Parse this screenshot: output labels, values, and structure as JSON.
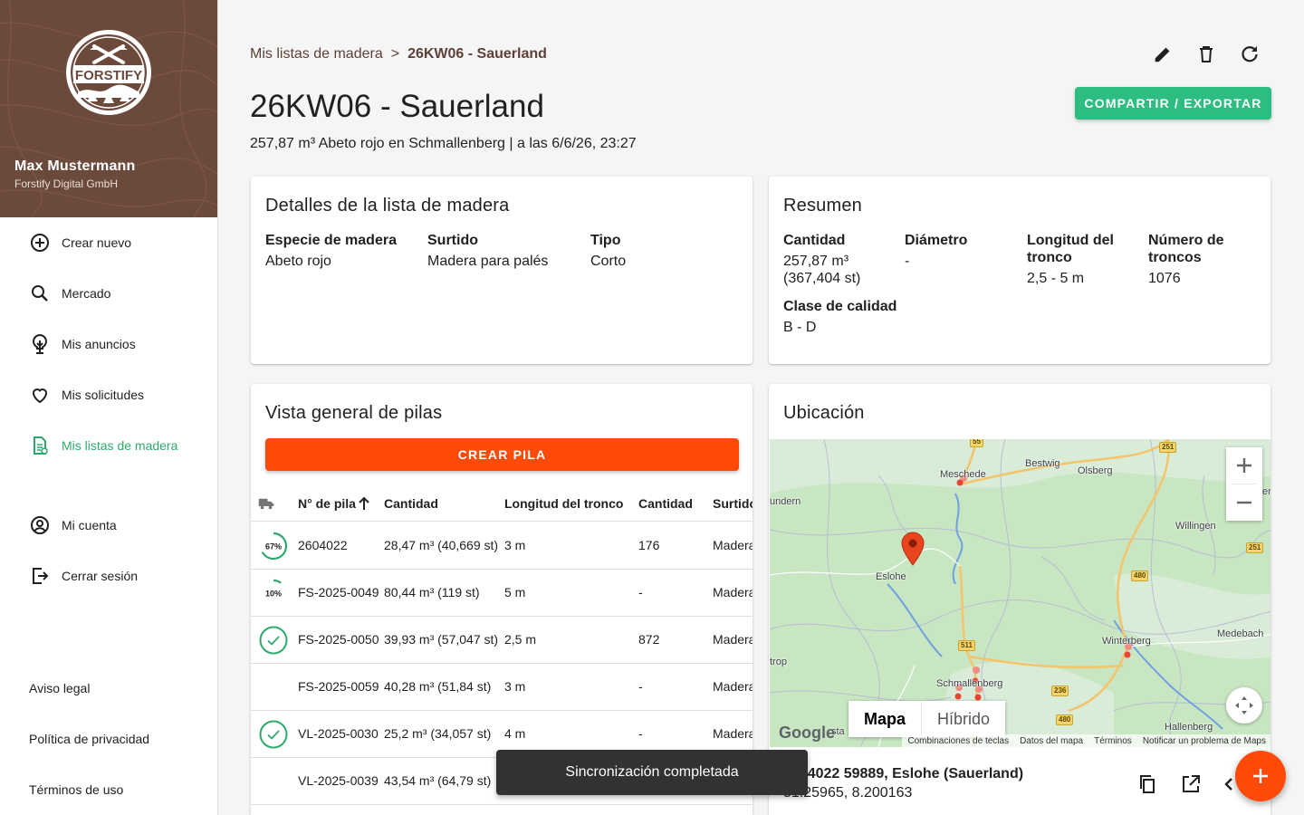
{
  "user": {
    "name": "Max Mustermann",
    "org": "Forstify Digital GmbH",
    "logo_text": "FORSTIFY"
  },
  "nav": [
    {
      "label": "Crear nuevo",
      "icon": "plus-circle-icon"
    },
    {
      "label": "Mercado",
      "icon": "search-icon"
    },
    {
      "label": "Mis anuncios",
      "icon": "tree-icon"
    },
    {
      "label": "Mis solicitudes",
      "icon": "heart-icon"
    },
    {
      "label": "Mis listas de madera",
      "icon": "document-list-icon",
      "active": true
    },
    {
      "label": "Mi cuenta",
      "icon": "account-icon"
    },
    {
      "label": "Cerrar sesión",
      "icon": "logout-icon"
    }
  ],
  "footer_links": [
    "Aviso legal",
    "Política de privacidad",
    "Términos de uso"
  ],
  "breadcrumb": {
    "parent": "Mis listas de madera",
    "separator": ">",
    "current": "26KW06 - Sauerland"
  },
  "page": {
    "title": "26KW06 - Sauerland",
    "subtitle": "257,87 m³ Abeto rojo en Schmallenberg | a las 6/6/26, 23:27",
    "share_button": "COMPARTIR / EXPORTAR"
  },
  "details": {
    "title": "Detalles de la lista de madera",
    "fields": [
      {
        "label": "Especie de madera",
        "value": "Abeto rojo"
      },
      {
        "label": "Surtido",
        "value": "Madera para palés"
      },
      {
        "label": "Tipo",
        "value": "Corto"
      }
    ]
  },
  "summary": {
    "title": "Resumen",
    "fields": [
      {
        "label": "Cantidad",
        "value": "257,87 m³\n(367,404 st)"
      },
      {
        "label": "Diámetro",
        "value": "-"
      },
      {
        "label": "Longitud del\ntronco",
        "value": "2,5 - 5 m"
      },
      {
        "label": "Número de\ntroncos",
        "value": "1076"
      },
      {
        "label": "Clase de calidad",
        "value": "B - D"
      }
    ]
  },
  "piles": {
    "title": "Vista general de pilas",
    "create_button": "CREAR PILA",
    "columns": [
      "N° de pila",
      "Cantidad",
      "Longitud del tronco",
      "Cantidad",
      "Surtido"
    ],
    "rows": [
      {
        "status": "progress",
        "progress": 0.67,
        "progress_label": "67%",
        "id": "2604022",
        "quantity": "28,47 m³ (40,669 st)",
        "length": "3 m",
        "count": "176",
        "assortment": "Madera para palés"
      },
      {
        "status": "progress",
        "progress": 0.1,
        "progress_label": "10%",
        "id": "FS-2025-0049",
        "quantity": "80,44 m³ (119 st)",
        "length": "5 m",
        "count": "-",
        "assortment": "Madera para palés"
      },
      {
        "status": "done",
        "id": "FS-2025-0050",
        "quantity": "39,93 m³ (57,047 st)",
        "length": "2,5 m",
        "count": "872",
        "assortment": "Madera para palés"
      },
      {
        "status": "none",
        "id": "FS-2025-0059",
        "quantity": "40,28 m³ (51,84 st)",
        "length": "3 m",
        "count": "-",
        "assortment": "Madera para palés"
      },
      {
        "status": "done",
        "id": "VL-2025-0030",
        "quantity": "25,2 m³ (34,057 st)",
        "length": "4 m",
        "count": "-",
        "assortment": "Madera para palés"
      },
      {
        "status": "none",
        "id": "VL-2025-0039",
        "quantity": "43,54 m³ (64,79 st)",
        "length": "",
        "count": "",
        "assortment": ""
      }
    ]
  },
  "location": {
    "title": "Ubicación",
    "map_type_map": "Mapa",
    "map_type_hybrid": "Híbrido",
    "google": "Google",
    "places": [
      "Meschede",
      "Bestwig",
      "Olsberg",
      "Willingen",
      "Eslohe",
      "Winterberg",
      "Medebach",
      "Schmallenberg",
      "Hallenberg",
      "undern",
      "trop",
      "er",
      "sta"
    ],
    "roads": [
      "55",
      "251",
      "251",
      "480",
      "511",
      "236",
      "480"
    ],
    "attribution": [
      "Combinaciones de teclas",
      "Datos del mapa",
      "Términos",
      "Notificar un problema de Maps"
    ],
    "address_line1": "2604022 59889, Eslohe (Sauerland)",
    "address_line2": "51.25965, 8.200163"
  },
  "snackbar": "Sincronización completada",
  "colors": {
    "accent_green": "#2ebd80",
    "accent_orange": "#ff4a0a",
    "brand_brown": "#6b4a3c"
  }
}
